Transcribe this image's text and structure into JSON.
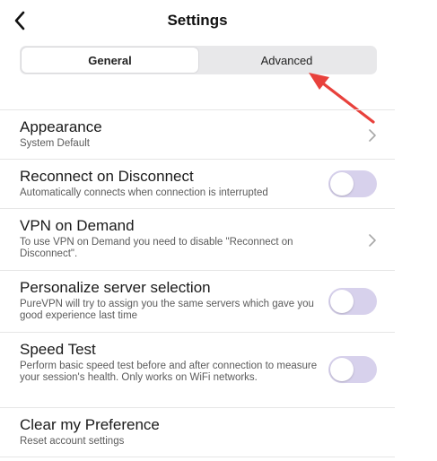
{
  "header": {
    "title": "Settings"
  },
  "tabs": [
    {
      "label": "General",
      "active": true
    },
    {
      "label": "Advanced",
      "active": false
    }
  ],
  "settings": [
    {
      "title": "Appearance",
      "description": "System Default",
      "control": "chevron"
    },
    {
      "title": "Reconnect on Disconnect",
      "description": "Automatically connects when connection is interrupted",
      "control": "toggle",
      "on": false
    },
    {
      "title": "VPN on Demand",
      "description": "To use VPN on Demand you need to disable \"Reconnect on Disconnect\".",
      "control": "chevron"
    },
    {
      "title": "Personalize server selection",
      "description": "PureVPN will try to assign you the same servers which gave you good experience last time",
      "control": "toggle",
      "on": false
    },
    {
      "title": "Speed Test",
      "description": "Perform basic speed test before and after connection to measure your session's health. Only works on WiFi networks.",
      "control": "toggle",
      "on": false
    },
    {
      "title": "Clear my Preference",
      "description": "Reset account settings",
      "control": "none"
    }
  ],
  "colors": {
    "toggle_track": "#d7d1ec",
    "annotation_arrow": "#e8413c",
    "segment_bg": "#e8e8ea"
  },
  "icons": {
    "back": "chevron-left-icon",
    "row_chevron": "chevron-right-icon",
    "annotation": "red-arrow-icon"
  }
}
